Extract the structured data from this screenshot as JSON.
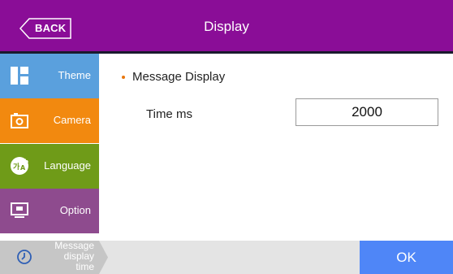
{
  "header": {
    "back_label": "BACK",
    "title": "Display"
  },
  "sidebar": {
    "items": [
      {
        "label": "Theme",
        "icon": "theme-icon",
        "color": "#5aa0dd"
      },
      {
        "label": "Camera",
        "icon": "camera-icon",
        "color": "#f2890f"
      },
      {
        "label": "Language",
        "icon": "language-icon",
        "color": "#6f9b18"
      },
      {
        "label": "Option",
        "icon": "option-icon",
        "color": "#8e4b8e"
      }
    ]
  },
  "main": {
    "section_title": "Message Display",
    "time_label": "Time ms",
    "time_value": "2000"
  },
  "breadcrumb": {
    "lines": [
      "Message",
      "display",
      "time"
    ],
    "icon": "clock-icon"
  },
  "footer": {
    "ok_label": "OK"
  },
  "colors": {
    "header": "#8a0d97",
    "accent_bullet": "#e8770e",
    "ok_button": "#4f86f7",
    "breadcrumb": "#c6c6c6"
  }
}
